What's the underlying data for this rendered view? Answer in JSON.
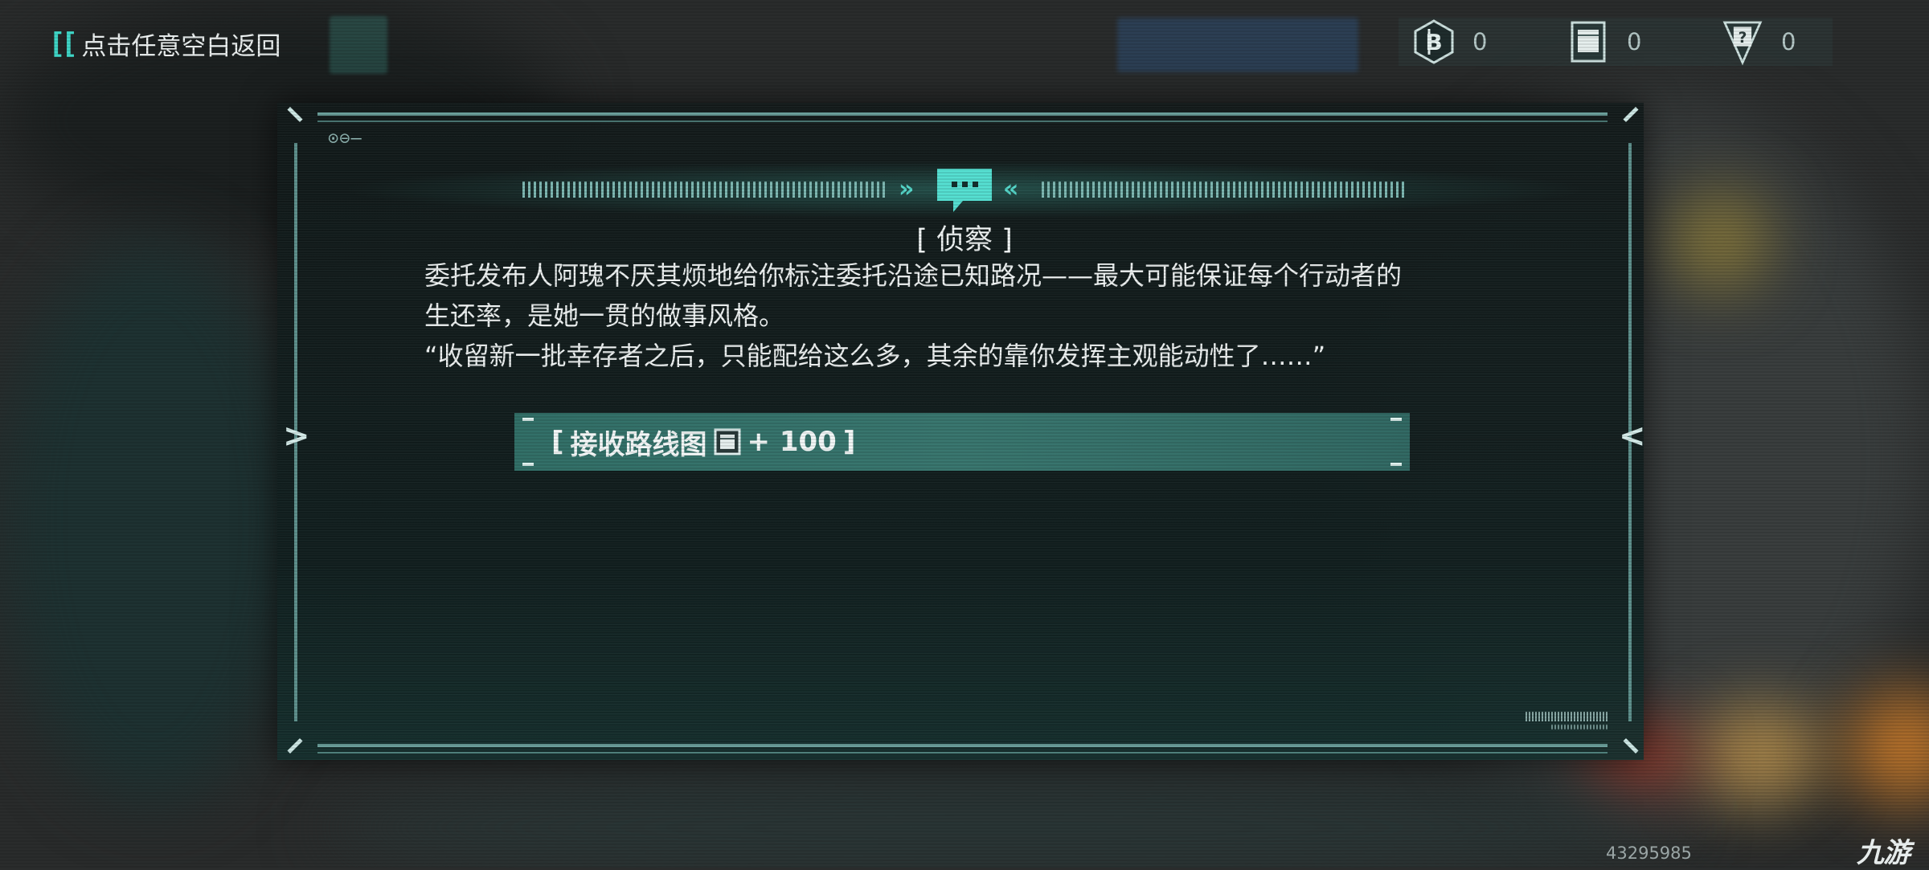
{
  "top_bar": {
    "back_bracket": "[[",
    "back_label": "点击任意空白返回"
  },
  "currencies": [
    {
      "icon": "b-coin-icon",
      "value": "0"
    },
    {
      "icon": "map-card-icon",
      "value": "0"
    },
    {
      "icon": "question-card-icon",
      "value": "0"
    }
  ],
  "dialog": {
    "header_left_mark": "»",
    "header_right_mark": "«",
    "header_icon": "speech-bubble-icon",
    "corner_dots": "⊙⊖—",
    "left_arrow": ">",
    "right_arrow": "<",
    "title": "[ 侦察 ]",
    "lines": [
      "委托发布人阿瑰不厌其烦地给你标注委托沿途已知路况——最大可能保证每个行动者的",
      "生还率，是她一贯的做事风格。",
      "“收留新一批幸存者之后，只能配给这么多，其余的靠你发挥主观能动性了……”"
    ],
    "option": {
      "open_bracket": "[",
      "text": "接收路线图",
      "icon": "map-card-icon",
      "amount": "+ 100",
      "close_bracket": "]"
    }
  },
  "footer": {
    "uid": "43295985",
    "watermark": "九游"
  },
  "colors": {
    "accent": "#3fd6c7",
    "option_bg": "#3a7a72",
    "frame": "#6b9f9b"
  }
}
